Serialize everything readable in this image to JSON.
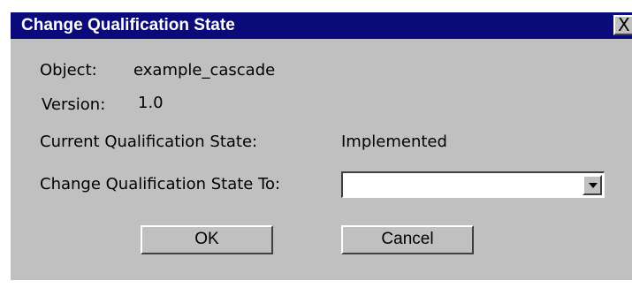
{
  "dialog": {
    "title": "Change Qualification State",
    "close_label": "X"
  },
  "fields": {
    "object_label": "Object:",
    "object_value": "example_cascade",
    "version_label": "Version:",
    "version_value": "1.0",
    "current_state_label": "Current Qualification State:",
    "current_state_value": "Implemented",
    "change_to_label": "Change Qualification State To:"
  },
  "select": {
    "selected_value": ""
  },
  "buttons": {
    "ok_label": "OK",
    "cancel_label": "Cancel"
  },
  "colors": {
    "titlebar": "#0a0a7a",
    "dialog_background": "#c0c0c0"
  }
}
